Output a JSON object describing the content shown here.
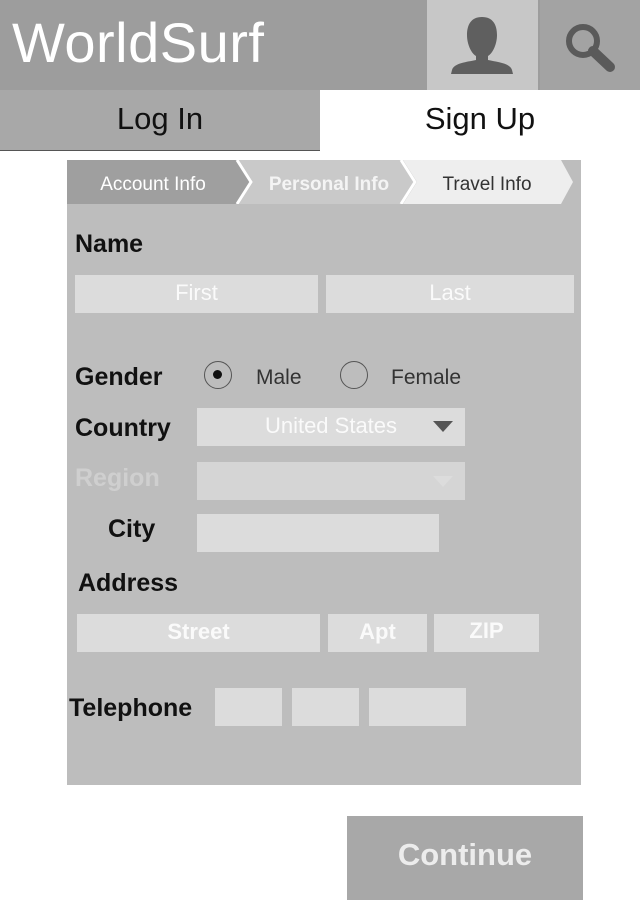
{
  "app": {
    "title": "WorldSurf"
  },
  "header": {
    "profile_icon": "person-icon",
    "search_icon": "search-icon"
  },
  "tabs": [
    {
      "label": "Log In",
      "active": false
    },
    {
      "label": "Sign Up",
      "active": true
    }
  ],
  "steps": [
    {
      "label": "Account Info",
      "state": "done"
    },
    {
      "label": "Personal Info",
      "state": "current"
    },
    {
      "label": "Travel Info",
      "state": "upcoming"
    }
  ],
  "form": {
    "name": {
      "label": "Name",
      "first_placeholder": "First",
      "last_placeholder": "Last"
    },
    "gender": {
      "label": "Gender",
      "options": [
        {
          "label": "Male",
          "selected": true
        },
        {
          "label": "Female",
          "selected": false
        }
      ]
    },
    "country": {
      "label": "Country",
      "value": "United States"
    },
    "region": {
      "label": "Region",
      "value": "",
      "disabled": true
    },
    "city": {
      "label": "City",
      "value": ""
    },
    "address": {
      "label": "Address",
      "street_placeholder": "Street",
      "apt_placeholder": "Apt",
      "zip_placeholder": "ZIP"
    },
    "telephone": {
      "label": "Telephone"
    }
  },
  "continue_label": "Continue",
  "colors": {
    "header_bg": "#9d9d9d",
    "panel_bg": "#bdbdbd",
    "field_bg": "#dcdcdc",
    "step_done": "#9f9f9f",
    "step_current": "#c9c9c9",
    "step_upcoming": "#eeeeee"
  }
}
